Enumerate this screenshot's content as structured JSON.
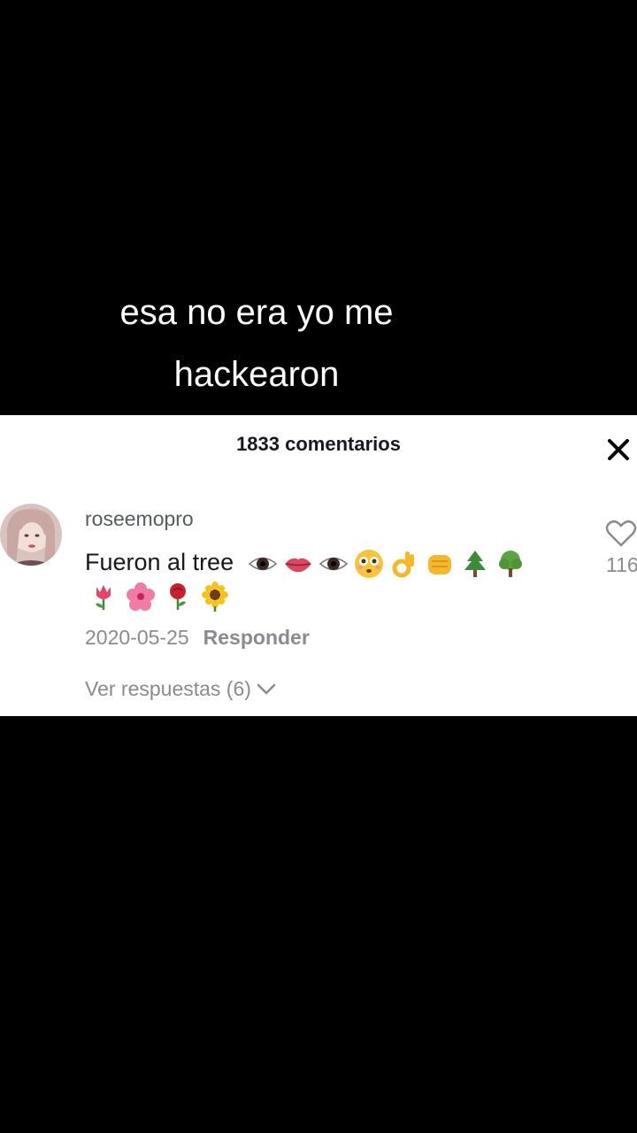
{
  "caption": {
    "line1": "esa no era yo me",
    "line2": "hackearon"
  },
  "comments_panel": {
    "title": "1833 comentarios",
    "comment": {
      "username": "roseemopro",
      "text": "Fueron al tree",
      "emojis_line1": [
        "eye",
        "lips",
        "eye",
        "flushed-face",
        "ok-hand",
        "oncoming-fist",
        "evergreen-tree",
        "deciduous-tree"
      ],
      "emojis_line2": [
        "tulip",
        "hibiscus",
        "rose",
        "sunflower"
      ],
      "date": "2020-05-25",
      "reply_label": "Responder",
      "like_count": "116",
      "view_replies": "Ver respuestas (6)"
    }
  }
}
